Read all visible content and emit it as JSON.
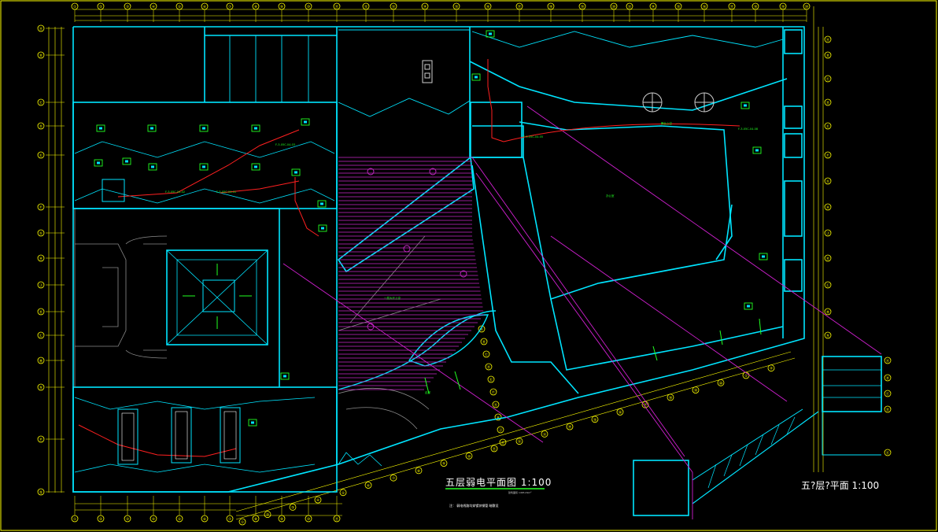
{
  "drawing": {
    "title_main": "五层弱电平面图   1:100",
    "title_secondary": "五?层?平面   1:100",
    "scale_note": "建筑面积 1465.09m²",
    "footnote": "注：  弱电线路均穿镀锌钢管  暗敷设",
    "room_label_hall": "一层大厅上空",
    "room_label_corridor": "走廊",
    "room_label_office": "办公室",
    "room_label_stage": "舞台上空"
  },
  "grid_top": [
    "①",
    "②",
    "③",
    "④",
    "⑤",
    "⑥",
    "⑦",
    "⑧",
    "⑨",
    "⑩",
    "⑪",
    "⑫",
    "⑬",
    "⑭",
    "⑮",
    "⑯",
    "⑰",
    "⑱",
    "⑲",
    "⑳"
  ],
  "grid_left": [
    "Ⓐ",
    "Ⓑ",
    "Ⓒ",
    "Ⓓ",
    "Ⓔ",
    "Ⓕ",
    "Ⓖ",
    "Ⓗ",
    "Ⓙ",
    "Ⓚ",
    "Ⓛ",
    "Ⓜ",
    "Ⓝ",
    "Ⓟ",
    "Ⓠ",
    "Ⓡ",
    "Ⓢ"
  ],
  "device_labels": [
    "F-3-05C-04-03",
    "F-3-05C-04-02",
    "F-3-05C-04-01",
    "F-3-05C-04-05",
    "F-3-05C-04-08"
  ],
  "colors": {
    "background": "#000000",
    "walls": "#00e5ff",
    "dimension": "#ffff00",
    "wiring": "#ff2020",
    "text_green": "#22ff22",
    "hatch": "#d020d0",
    "device": "#00ff66",
    "light_lines": "#9a9a9a",
    "frame": "#ffff00"
  }
}
